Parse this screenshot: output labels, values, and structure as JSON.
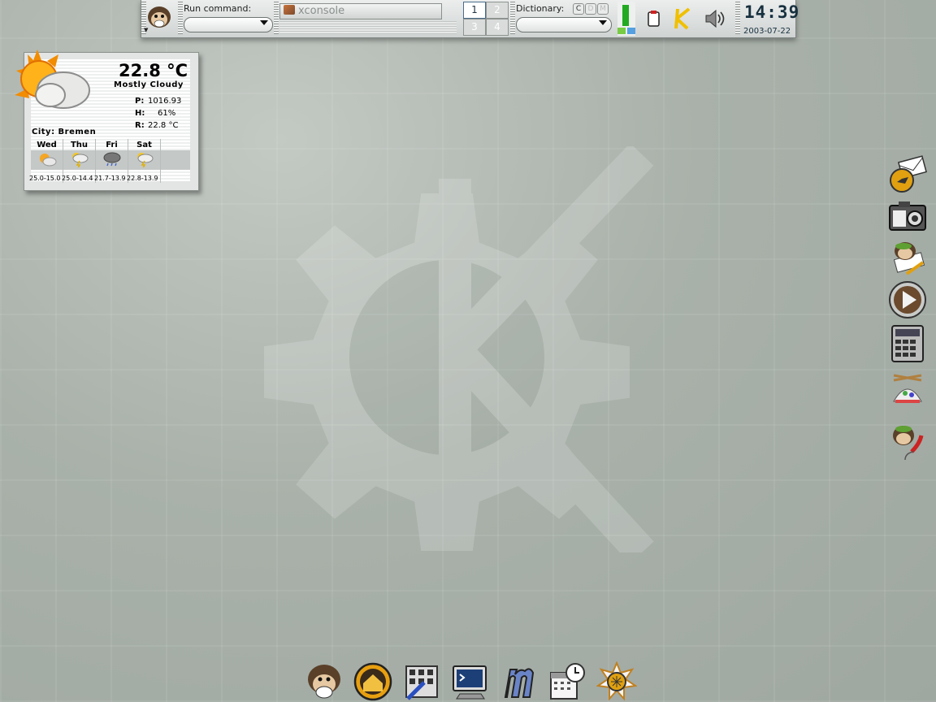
{
  "panel": {
    "kmenu_icon": "monkey-kmenu-icon",
    "run_command_label": "Run command:",
    "run_command_value": "",
    "task_xconsole": "xconsole",
    "desktops": [
      "1",
      "2",
      "3",
      "4"
    ],
    "active_desktop": "1",
    "dictionary_label": "Dictionary:",
    "dictionary_buttons": [
      "C",
      "D",
      "M"
    ],
    "dictionary_value": "",
    "clock_time": "14:39",
    "clock_date": "2003-07-22",
    "tray_icons": [
      "klipper-clipboard-icon",
      "kde-k-icon",
      "speaker-volume-icon"
    ]
  },
  "weather": {
    "temperature": "22.8 °C",
    "condition": "Mostly Cloudy",
    "pressure_label": "P:",
    "pressure": "1016.93",
    "humidity_label": "H:",
    "humidity": "61%",
    "realfeel_label": "R:",
    "realfeel": "22.8 °C",
    "city": "City: Bremen",
    "forecast": [
      {
        "day": "Wed",
        "range": "25.0-15.0",
        "icon": "sun-cloud-icon"
      },
      {
        "day": "Thu",
        "range": "25.0-14.4",
        "icon": "thunderstorm-icon"
      },
      {
        "day": "Fri",
        "range": "21.7-13.9",
        "icon": "storm-cloud-icon"
      },
      {
        "day": "Sat",
        "range": "22.8-13.9",
        "icon": "thunderstorm-icon"
      }
    ]
  },
  "desktop_icons_right": [
    "mail-icon",
    "camera-icon",
    "monkey-notes-icon",
    "media-player-icon",
    "calculator-icon",
    "helicopter-hat-icon",
    "monkey-phone-icon"
  ],
  "dock_icons": [
    "monkey-icon",
    "home-icon",
    "control-center-icon",
    "terminal-icon",
    "m-app-icon",
    "calendar-clock-icon",
    "web-browser-icon"
  ],
  "colors": {
    "clock_text": "#17303f",
    "panel_bg": "#dfe2e1",
    "desktop_bg": "#a9b1aa"
  }
}
